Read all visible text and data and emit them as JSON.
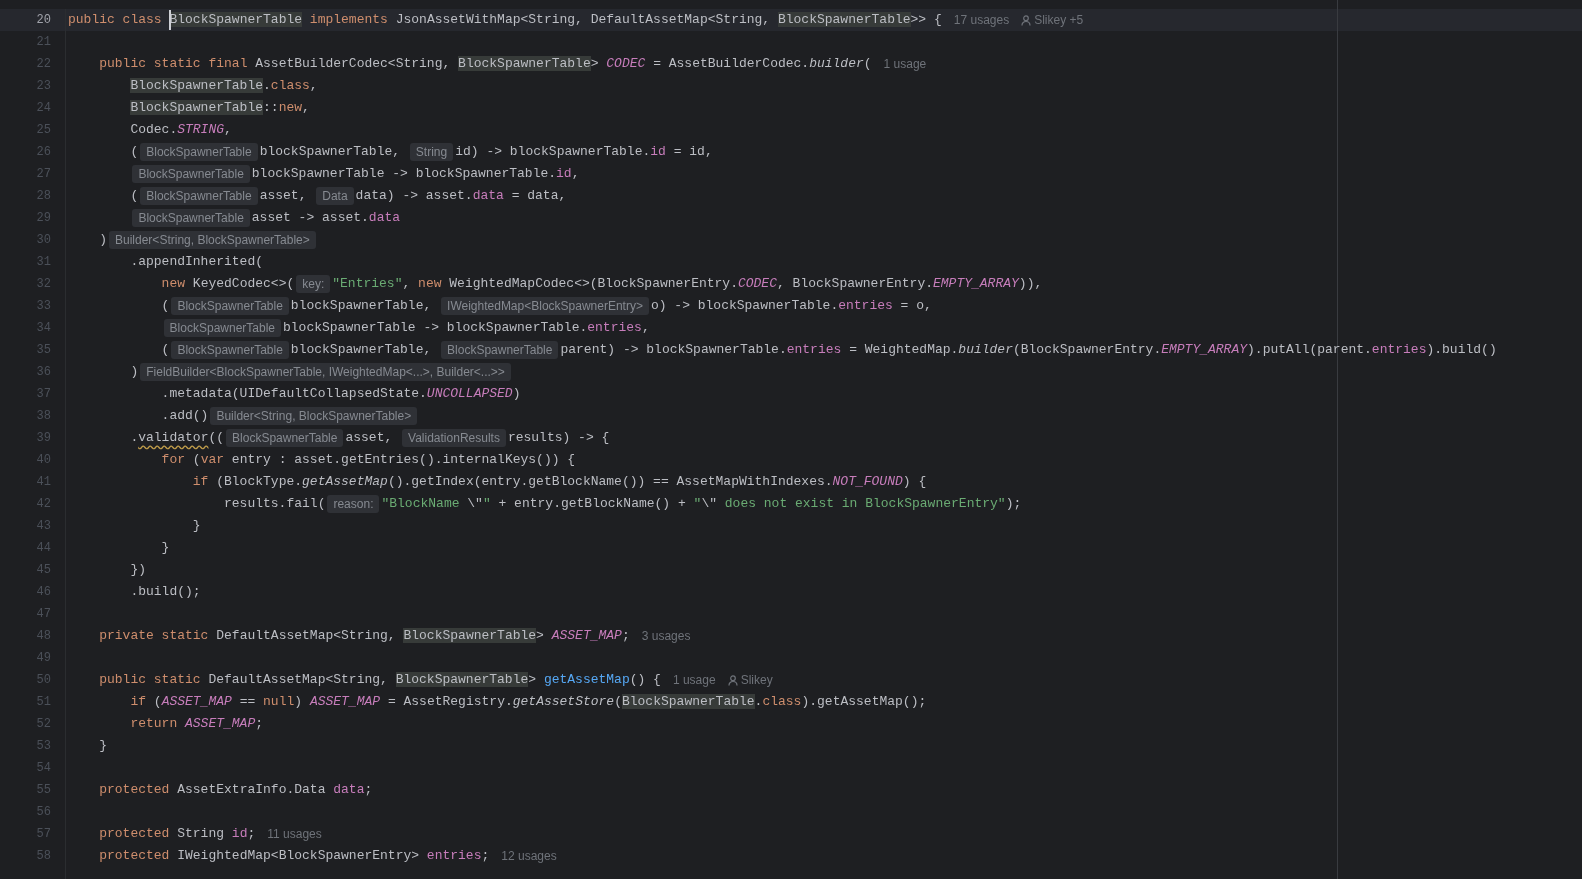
{
  "lines": [
    {
      "number": "20",
      "current": true,
      "tokens": [
        {
          "kind": "keyword",
          "t": "public class "
        },
        {
          "kind": "highlight",
          "t": "BlockSpawnerTable",
          "caret": true
        },
        {
          "kind": "keyword",
          "t": " implements "
        },
        {
          "kind": "plain",
          "t": "JsonAssetWithMap<String, DefaultAssetMap<String, "
        },
        {
          "kind": "highlight",
          "t": "BlockSpawnerTable"
        },
        {
          "kind": "plain",
          "t": ">> {"
        },
        {
          "kind": "usage",
          "t": "17 usages"
        },
        {
          "kind": "author",
          "t": "Slikey +5"
        }
      ],
      "children": [
        {
          "number": "21",
          "current": false
        },
        {
          "number": "22",
          "current": false,
          "tokens": [
            {
              "kind": "keyword",
              "t": "public static final "
            },
            {
              "kind": "plain",
              "t": "AssetBuilderCodec<String, "
            },
            {
              "kind": "highlight",
              "t": "BlockSpawnerTable"
            },
            {
              "kind": "plain",
              "t": "> "
            },
            {
              "kind": "constant",
              "t": "CODEC"
            },
            {
              "kind": "plain",
              "t": " = AssetBuilderCodec."
            },
            {
              "kind": "call",
              "t": "builder"
            },
            {
              "kind": "plain",
              "t": "("
            },
            {
              "kind": "usage",
              "t": "1 usage"
            }
          ],
          "children": [
            {
              "number": "23",
              "current": false,
              "tokens": [
                {
                  "kind": "highlight",
                  "t": "BlockSpawnerTable"
                },
                {
                  "kind": "plain",
                  "t": "."
                },
                {
                  "kind": "keyword",
                  "t": "class"
                },
                {
                  "kind": "plain",
                  "t": ","
                }
              ]
            },
            {
              "number": "24",
              "current": false,
              "tokens": [
                {
                  "kind": "highlight",
                  "t": "BlockSpawnerTable"
                },
                {
                  "kind": "plain",
                  "t": "::"
                },
                {
                  "kind": "keyword",
                  "t": "new"
                },
                {
                  "kind": "plain",
                  "t": ","
                }
              ]
            },
            {
              "number": "25",
              "current": false,
              "tokens": [
                {
                  "kind": "plain",
                  "t": "Codec."
                },
                {
                  "kind": "constant",
                  "t": "STRING"
                },
                {
                  "kind": "plain",
                  "t": ","
                }
              ]
            },
            {
              "number": "26",
              "current": false,
              "tokens": [
                {
                  "kind": "plain",
                  "t": "("
                },
                {
                  "kind": "hint",
                  "t": "BlockSpawnerTable"
                },
                {
                  "kind": "plain",
                  "t": "blockSpawnerTable, "
                },
                {
                  "kind": "hint",
                  "t": "String"
                },
                {
                  "kind": "plain",
                  "t": "id) -> blockSpawnerTable."
                },
                {
                  "kind": "field",
                  "t": "id"
                },
                {
                  "kind": "plain",
                  "t": " = id,"
                }
              ]
            },
            {
              "number": "27",
              "current": false,
              "tokens": [
                {
                  "kind": "hint",
                  "t": "BlockSpawnerTable"
                },
                {
                  "kind": "plain",
                  "t": "blockSpawnerTable -> blockSpawnerTable."
                },
                {
                  "kind": "field",
                  "t": "id"
                },
                {
                  "kind": "plain",
                  "t": ","
                }
              ]
            },
            {
              "number": "28",
              "current": false,
              "tokens": [
                {
                  "kind": "plain",
                  "t": "("
                },
                {
                  "kind": "hint",
                  "t": "BlockSpawnerTable"
                },
                {
                  "kind": "plain",
                  "t": "asset, "
                },
                {
                  "kind": "hint",
                  "t": "Data"
                },
                {
                  "kind": "plain",
                  "t": "data) -> asset."
                },
                {
                  "kind": "field",
                  "t": "data"
                },
                {
                  "kind": "plain",
                  "t": " = data,"
                }
              ]
            },
            {
              "number": "29",
              "current": false,
              "tokens": [
                {
                  "kind": "hint",
                  "t": "BlockSpawnerTable"
                },
                {
                  "kind": "plain",
                  "t": "asset -> asset."
                },
                {
                  "kind": "field",
                  "t": "data"
                }
              ]
            }
          ]
        },
        {
          "number": "30",
          "current": false,
          "tokens": [
            {
              "kind": "plain",
              "t": ")"
            },
            {
              "kind": "hint",
              "t": "Builder<String, BlockSpawnerTable>"
            }
          ],
          "children": [
            {
              "number": "31",
              "current": false,
              "tokens": [
                {
                  "kind": "plain",
                  "t": ".appendInherited("
                }
              ],
              "children": [
                {
                  "number": "32",
                  "current": false,
                  "tokens": [
                    {
                      "kind": "keyword",
                      "t": "new "
                    },
                    {
                      "kind": "plain",
                      "t": "KeyedCodec<>("
                    },
                    {
                      "kind": "hint",
                      "t": "key:"
                    },
                    {
                      "kind": "string",
                      "t": "\"Entries\""
                    },
                    {
                      "kind": "plain",
                      "t": ", "
                    },
                    {
                      "kind": "keyword",
                      "t": "new "
                    },
                    {
                      "kind": "plain",
                      "t": "WeightedMapCodec<>(BlockSpawnerEntry."
                    },
                    {
                      "kind": "constant",
                      "t": "CODEC"
                    },
                    {
                      "kind": "plain",
                      "t": ", BlockSpawnerEntry."
                    },
                    {
                      "kind": "constant",
                      "t": "EMPTY_ARRAY"
                    },
                    {
                      "kind": "plain",
                      "t": ")),"
                    }
                  ]
                },
                {
                  "number": "33",
                  "current": false,
                  "tokens": [
                    {
                      "kind": "plain",
                      "t": "("
                    },
                    {
                      "kind": "hint",
                      "t": "BlockSpawnerTable"
                    },
                    {
                      "kind": "plain",
                      "t": "blockSpawnerTable, "
                    },
                    {
                      "kind": "hint",
                      "t": "IWeightedMap<BlockSpawnerEntry>"
                    },
                    {
                      "kind": "plain",
                      "t": "o) -> blockSpawnerTable."
                    },
                    {
                      "kind": "field",
                      "t": "entries"
                    },
                    {
                      "kind": "plain",
                      "t": " = o,"
                    }
                  ]
                },
                {
                  "number": "34",
                  "current": false,
                  "tokens": [
                    {
                      "kind": "hint",
                      "t": "BlockSpawnerTable"
                    },
                    {
                      "kind": "plain",
                      "t": "blockSpawnerTable -> blockSpawnerTable."
                    },
                    {
                      "kind": "field",
                      "t": "entries"
                    },
                    {
                      "kind": "plain",
                      "t": ","
                    }
                  ]
                },
                {
                  "number": "35",
                  "current": false,
                  "tokens": [
                    {
                      "kind": "plain",
                      "t": "("
                    },
                    {
                      "kind": "hint",
                      "t": "BlockSpawnerTable"
                    },
                    {
                      "kind": "plain",
                      "t": "blockSpawnerTable, "
                    },
                    {
                      "kind": "hint",
                      "t": "BlockSpawnerTable"
                    },
                    {
                      "kind": "plain",
                      "t": "parent) -> blockSpawnerTable."
                    },
                    {
                      "kind": "field",
                      "t": "entries"
                    },
                    {
                      "kind": "plain",
                      "t": " = WeightedMap."
                    },
                    {
                      "kind": "call",
                      "t": "builder"
                    },
                    {
                      "kind": "plain",
                      "t": "(BlockSpawnerEntry."
                    },
                    {
                      "kind": "constant",
                      "t": "EMPTY_ARRAY"
                    },
                    {
                      "kind": "plain",
                      "t": ").putAll(parent."
                    },
                    {
                      "kind": "field",
                      "t": "entries"
                    },
                    {
                      "kind": "plain",
                      "t": ").build()"
                    }
                  ]
                }
              ]
            },
            {
              "number": "36",
              "current": false,
              "tokens": [
                {
                  "kind": "plain",
                  "t": ")"
                },
                {
                  "kind": "hint",
                  "t": "FieldBuilder<BlockSpawnerTable, IWeightedMap<...>, Builder<...>>"
                }
              ],
              "children": [
                {
                  "number": "37",
                  "current": false,
                  "tokens": [
                    {
                      "kind": "plain",
                      "t": ".metadata(UIDefaultCollapsedState."
                    },
                    {
                      "kind": "constant",
                      "t": "UNCOLLAPSED"
                    },
                    {
                      "kind": "plain",
                      "t": ")"
                    }
                  ]
                },
                {
                  "number": "38",
                  "current": false,
                  "tokens": [
                    {
                      "kind": "plain",
                      "t": ".add()"
                    },
                    {
                      "kind": "hint",
                      "t": "Builder<String, BlockSpawnerTable>"
                    }
                  ]
                }
              ]
            },
            {
              "number": "39",
              "current": false,
              "tokens": [
                {
                  "kind": "plain",
                  "t": "."
                },
                {
                  "kind": "warning",
                  "t": "validator"
                },
                {
                  "kind": "plain",
                  "t": "(("
                },
                {
                  "kind": "hint",
                  "t": "BlockSpawnerTable"
                },
                {
                  "kind": "plain",
                  "t": "asset, "
                },
                {
                  "kind": "hint",
                  "t": "ValidationResults"
                },
                {
                  "kind": "plain",
                  "t": "results) -> {"
                }
              ],
              "children": [
                {
                  "number": "40",
                  "current": false,
                  "tokens": [
                    {
                      "kind": "keyword",
                      "t": "for "
                    },
                    {
                      "kind": "plain",
                      "t": "("
                    },
                    {
                      "kind": "keyword",
                      "t": "var "
                    },
                    {
                      "kind": "plain",
                      "t": "entry : asset.getEntries().internalKeys()) {"
                    }
                  ],
                  "children": [
                    {
                      "number": "41",
                      "current": false,
                      "tokens": [
                        {
                          "kind": "keyword",
                          "t": "if "
                        },
                        {
                          "kind": "plain",
                          "t": "(BlockType."
                        },
                        {
                          "kind": "call",
                          "t": "getAssetMap"
                        },
                        {
                          "kind": "plain",
                          "t": "().getIndex(entry.getBlockName()) == AssetMapWithIndexes."
                        },
                        {
                          "kind": "constant",
                          "t": "NOT_FOUND"
                        },
                        {
                          "kind": "plain",
                          "t": ") {"
                        }
                      ],
                      "children": [
                        {
                          "number": "42",
                          "current": false,
                          "tokens": [
                            {
                              "kind": "plain",
                              "t": "results.fail("
                            },
                            {
                              "kind": "hint",
                              "t": "reason:"
                            },
                            {
                              "kind": "string",
                              "t": "\"BlockName "
                            },
                            {
                              "kind": "plain",
                              "t": "\\\""
                            },
                            {
                              "kind": "string",
                              "t": "\""
                            },
                            {
                              "kind": "plain",
                              "t": " + entry.getBlockName() + "
                            },
                            {
                              "kind": "string",
                              "t": "\""
                            },
                            {
                              "kind": "plain",
                              "t": "\\\""
                            },
                            {
                              "kind": "string",
                              "t": " does not exist in BlockSpawnerEntry\""
                            },
                            {
                              "kind": "plain",
                              "t": ");"
                            }
                          ]
                        }
                      ]
                    },
                    {
                      "number": "43",
                      "current": false,
                      "tokens": [
                        {
                          "kind": "plain",
                          "t": "}"
                        }
                      ]
                    }
                  ]
                },
                {
                  "number": "44",
                  "current": false,
                  "tokens": [
                    {
                      "kind": "plain",
                      "t": "}"
                    }
                  ]
                }
              ]
            },
            {
              "number": "45",
              "current": false,
              "tokens": [
                {
                  "kind": "plain",
                  "t": "})"
                }
              ]
            },
            {
              "number": "46",
              "current": false,
              "tokens": [
                {
                  "kind": "plain",
                  "t": ".build();"
                }
              ]
            }
          ]
        },
        {
          "number": "47",
          "current": false
        },
        {
          "number": "48",
          "current": false,
          "tokens": [
            {
              "kind": "keyword",
              "t": "private static "
            },
            {
              "kind": "plain",
              "t": "DefaultAssetMap<String, "
            },
            {
              "kind": "highlight",
              "t": "BlockSpawnerTable"
            },
            {
              "kind": "plain",
              "t": "> "
            },
            {
              "kind": "constant",
              "t": "ASSET_MAP"
            },
            {
              "kind": "plain",
              "t": ";"
            },
            {
              "kind": "usage",
              "t": "3 usages"
            }
          ]
        },
        {
          "number": "49",
          "current": false
        },
        {
          "number": "50",
          "current": false,
          "tokens": [
            {
              "kind": "keyword",
              "t": "public static "
            },
            {
              "kind": "plain",
              "t": "DefaultAssetMap<String, "
            },
            {
              "kind": "highlight",
              "t": "BlockSpawnerTable"
            },
            {
              "kind": "plain",
              "t": "> "
            },
            {
              "kind": "declaration",
              "t": "getAssetMap"
            },
            {
              "kind": "plain",
              "t": "() {"
            },
            {
              "kind": "usage",
              "t": "1 usage"
            },
            {
              "kind": "author",
              "t": "Slikey"
            }
          ],
          "children": [
            {
              "number": "51",
              "current": false,
              "tokens": [
                {
                  "kind": "keyword",
                  "t": "if "
                },
                {
                  "kind": "plain",
                  "t": "("
                },
                {
                  "kind": "constant",
                  "t": "ASSET_MAP"
                },
                {
                  "kind": "plain",
                  "t": " == "
                },
                {
                  "kind": "keyword",
                  "t": "null"
                },
                {
                  "kind": "plain",
                  "t": ") "
                },
                {
                  "kind": "constant",
                  "t": "ASSET_MAP"
                },
                {
                  "kind": "plain",
                  "t": " = AssetRegistry."
                },
                {
                  "kind": "call",
                  "t": "getAssetStore"
                },
                {
                  "kind": "plain",
                  "t": "("
                },
                {
                  "kind": "highlight",
                  "t": "BlockSpawnerTable"
                },
                {
                  "kind": "plain",
                  "t": "."
                },
                {
                  "kind": "keyword",
                  "t": "class"
                },
                {
                  "kind": "plain",
                  "t": ").getAssetMap();"
                }
              ]
            },
            {
              "number": "52",
              "current": false,
              "tokens": [
                {
                  "kind": "keyword",
                  "t": "return "
                },
                {
                  "kind": "constant",
                  "t": "ASSET_MAP"
                },
                {
                  "kind": "plain",
                  "t": ";"
                }
              ]
            }
          ]
        },
        {
          "number": "53",
          "current": false,
          "tokens": [
            {
              "kind": "plain",
              "t": "}"
            }
          ]
        },
        {
          "number": "54",
          "current": false
        },
        {
          "number": "55",
          "current": false,
          "tokens": [
            {
              "kind": "keyword",
              "t": "protected "
            },
            {
              "kind": "plain",
              "t": "AssetExtraInfo.Data "
            },
            {
              "kind": "field",
              "t": "data"
            },
            {
              "kind": "plain",
              "t": ";"
            }
          ]
        },
        {
          "number": "56",
          "current": false
        },
        {
          "number": "57",
          "current": false,
          "tokens": [
            {
              "kind": "keyword",
              "t": "protected "
            },
            {
              "kind": "plain",
              "t": "String "
            },
            {
              "kind": "field",
              "t": "id"
            },
            {
              "kind": "plain",
              "t": ";"
            },
            {
              "kind": "usage",
              "t": "11 usages"
            }
          ]
        },
        {
          "number": "58",
          "current": false,
          "tokens": [
            {
              "kind": "keyword",
              "t": "protected "
            },
            {
              "kind": "plain",
              "t": "IWeightedMap<BlockSpawnerEntry> "
            },
            {
              "kind": "field",
              "t": "entries"
            },
            {
              "kind": "plain",
              "t": ";"
            },
            {
              "kind": "usage",
              "t": "12 usages"
            }
          ]
        }
      ]
    }
  ]
}
